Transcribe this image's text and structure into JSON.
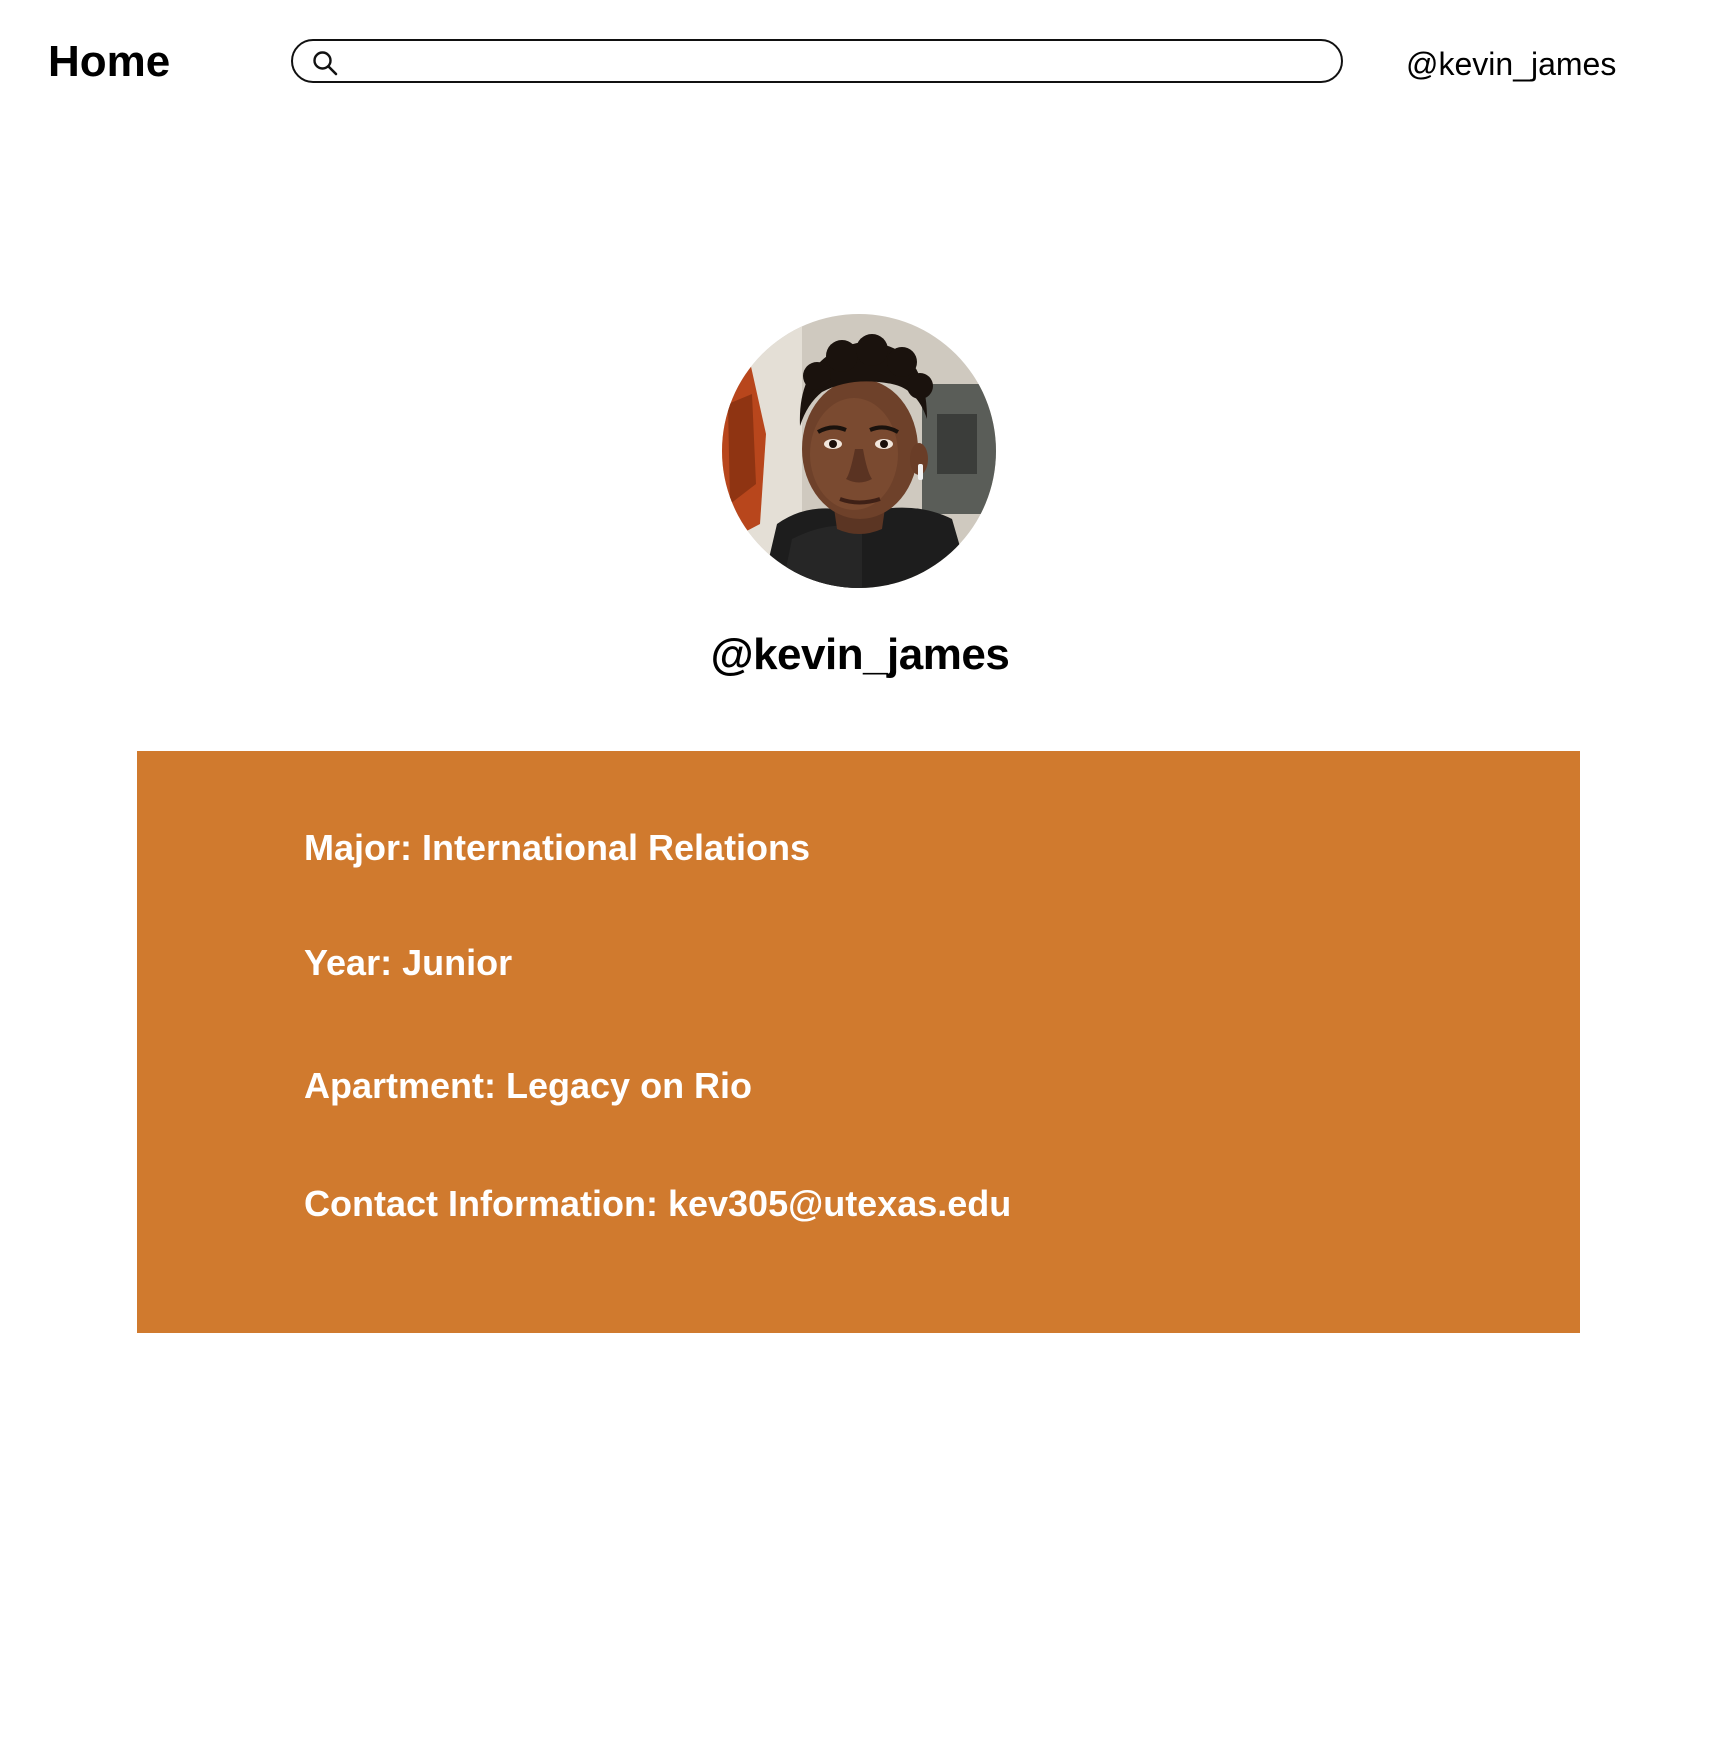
{
  "header": {
    "home_label": "Home",
    "search_placeholder": "",
    "search_value": "",
    "user_handle": "@kevin_james"
  },
  "profile": {
    "username": "@kevin_james",
    "avatar_icon": "profile-photo"
  },
  "info": {
    "major": "Major: International Relations",
    "year": "Year: Junior",
    "apartment": "Apartment: Legacy on Rio",
    "contact": "Contact Information: kev305@utexas.edu"
  },
  "colors": {
    "panel": "#d07a2e",
    "panel_text": "#ffffff",
    "text": "#000000"
  }
}
